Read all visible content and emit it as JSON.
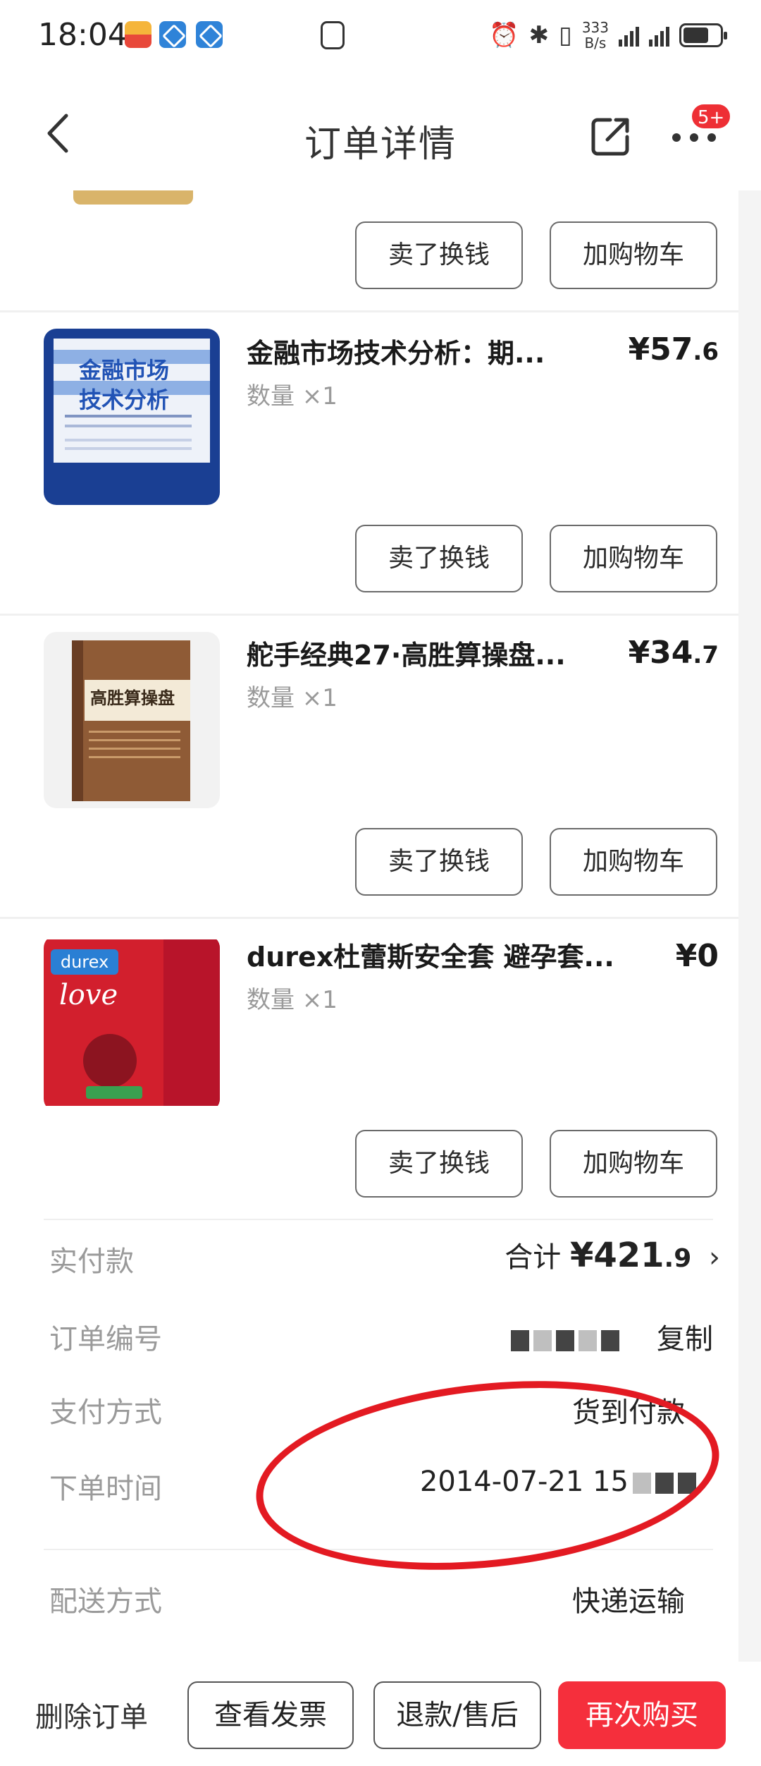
{
  "status_bar": {
    "time": "18:04",
    "net_speed_value": "333",
    "net_speed_unit": "B/s"
  },
  "nav": {
    "title": "订单详情",
    "badge": "5+"
  },
  "item_buttons": {
    "sell": "卖了换钱",
    "add_cart": "加购物车"
  },
  "items": [
    {
      "title": "金融市场技术分析：期...",
      "quantity": "数量 ×1",
      "price_main": "¥57",
      "price_decimal": ".6",
      "cover_text": [
        "金融市场",
        "技术分析"
      ]
    },
    {
      "title": "舵手经典27·高胜算操盘...",
      "quantity": "数量 ×1",
      "price_main": "¥34",
      "price_decimal": ".7",
      "cover_text": [
        "高胜算操盘"
      ]
    },
    {
      "title": "durex杜蕾斯安全套 避孕套...",
      "quantity": "数量 ×1",
      "price_main": "¥0",
      "price_decimal": "",
      "cover_text": [
        "durex",
        "love"
      ]
    }
  ],
  "summary": {
    "paid_label": "实付款",
    "total_prefix": "合计 ",
    "total_main": "¥421",
    "total_decimal": ".9",
    "chevron": "›",
    "order_no_label": "订单编号",
    "copy_label": "复制",
    "payment_label": "支付方式",
    "payment_value": "货到付款",
    "order_time_label": "下单时间",
    "order_time_value": "2014-07-21 15",
    "delivery_label": "配送方式",
    "delivery_value": "快递运输"
  },
  "bottom_bar": {
    "delete": "删除订单",
    "invoice": "查看发票",
    "refund": "退款/售后",
    "rebuy": "再次购买"
  },
  "colors": {
    "accent": "#f52f3c",
    "badge": "#ee2f35",
    "circle_annotation": "#e31a22"
  }
}
